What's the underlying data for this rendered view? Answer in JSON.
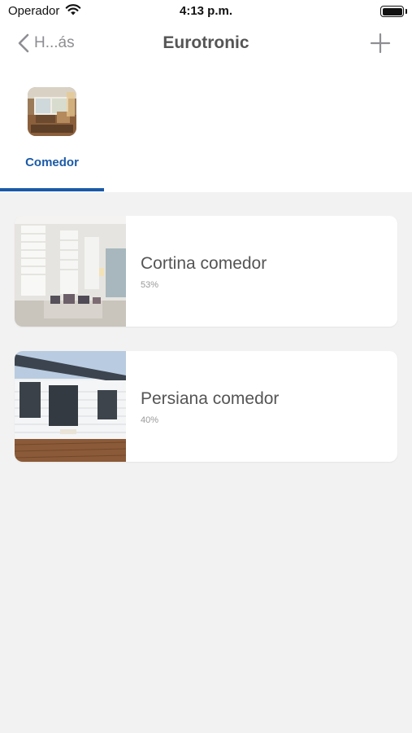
{
  "status_bar": {
    "carrier": "Operador",
    "time": "4:13 p.m."
  },
  "nav": {
    "back_label": "H...ás",
    "title": "Eurotronic"
  },
  "rooms": [
    {
      "label": "Comedor",
      "selected": true
    }
  ],
  "devices": [
    {
      "name": "Cortina comedor",
      "level": "53%"
    },
    {
      "name": "Persiana comedor",
      "level": "40%"
    }
  ],
  "colors": {
    "accent": "#1b5aa8",
    "background": "#f2f2f2",
    "card": "#ffffff",
    "title": "#555555"
  },
  "icons": {
    "back": "chevron-left-icon",
    "add": "plus-icon",
    "wifi": "wifi-icon",
    "battery": "battery-icon"
  }
}
